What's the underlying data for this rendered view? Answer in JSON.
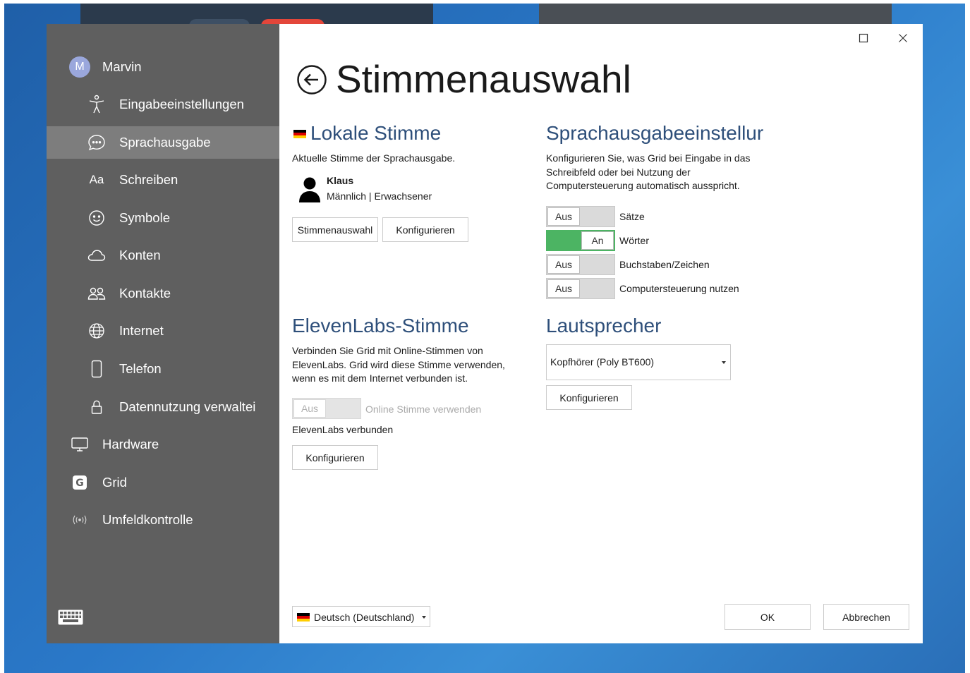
{
  "sidebar": {
    "user": {
      "initial": "M",
      "name": "Marvin"
    },
    "items": [
      {
        "label": "Eingabeeinstellungen",
        "icon": "accessibility-icon"
      },
      {
        "label": "Sprachausgabe",
        "icon": "speech-bubble-icon",
        "active": true
      },
      {
        "label": "Schreiben",
        "icon": "text-aa-icon"
      },
      {
        "label": "Symbole",
        "icon": "smiley-icon"
      },
      {
        "label": "Konten",
        "icon": "cloud-icon"
      },
      {
        "label": "Kontakte",
        "icon": "contacts-icon"
      },
      {
        "label": "Internet",
        "icon": "globe-icon"
      },
      {
        "label": "Telefon",
        "icon": "phone-icon"
      },
      {
        "label": "Datennutzung verwaltei",
        "icon": "lock-icon"
      }
    ],
    "top_items": [
      {
        "label": "Hardware",
        "icon": "monitor-icon"
      },
      {
        "label": "Grid",
        "icon": "grid-logo-icon"
      },
      {
        "label": "Umfeldkontrolle",
        "icon": "wireless-icon"
      }
    ],
    "keyboard_icon": "keyboard-icon"
  },
  "main": {
    "title": "Stimmenauswahl",
    "local_voice": {
      "heading": "Lokale Stimme",
      "description": "Aktuelle Stimme der Sprachausgabe.",
      "voice_name": "Klaus",
      "voice_meta": "Männlich | Erwachsener",
      "btn_select": "Stimmenauswahl",
      "btn_configure": "Konfigurieren"
    },
    "speech_settings": {
      "heading": "Sprachausgabeeinstellur",
      "description": "Konfigurieren Sie, was Grid bei Eingabe in das Schreibfeld oder bei Nutzung der Computersteuerung automatisch ausspricht.",
      "toggles": [
        {
          "state": "Aus",
          "label": "Sätze"
        },
        {
          "state": "An",
          "label": "Wörter"
        },
        {
          "state": "Aus",
          "label": "Buchstaben/Zeichen"
        },
        {
          "state": "Aus",
          "label": "Computersteuerung nutzen"
        }
      ]
    },
    "elevenlabs": {
      "heading": "ElevenLabs-Stimme",
      "description": "Verbinden Sie Grid mit Online-Stimmen von ElevenLabs. Grid wird diese Stimme verwenden, wenn es mit dem Internet verbunden ist.",
      "toggle_state": "Aus",
      "toggle_label": "Online Stimme verwenden",
      "status": "ElevenLabs verbunden",
      "btn_configure": "Konfigurieren"
    },
    "speaker": {
      "heading": "Lautsprecher",
      "selected": "Kopfhörer (Poly BT600)",
      "btn_configure": "Konfigurieren"
    },
    "footer": {
      "language": "Deutsch (Deutschland)",
      "ok": "OK",
      "cancel": "Abbrechen"
    }
  },
  "colors": {
    "sidebar_bg": "#5f5f5f",
    "sidebar_active": "#7d7d7d",
    "heading": "#2e4f7a",
    "toggle_on": "#4cb463"
  }
}
